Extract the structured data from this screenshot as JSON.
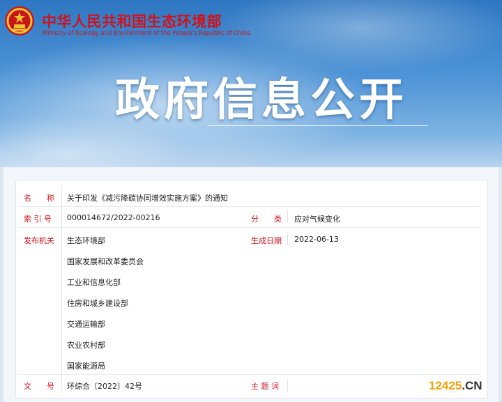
{
  "header": {
    "ministry_cn": "中华人民共和国生态环境部",
    "ministry_en": "Ministry of Ecology and Environment of the People's Republic of China",
    "banner_title": "政府信息公开",
    "emblem_icon": "national-emblem-icon"
  },
  "info": {
    "name_label": "名　　称",
    "name_value": "关于印发《减污降碳协同增效实施方案》的通知",
    "index_label": "索 引 号",
    "index_value": "000014672/2022-00216",
    "category_label": "分　　类",
    "category_value": "应对气候变化",
    "issuer_label": "发布机关",
    "issuers": [
      "生态环境部",
      "国家发展和改革委员会",
      "工业和信息化部",
      "住房和城乡建设部",
      "交通运输部",
      "农业农村部",
      "国家能源局"
    ],
    "date_label": "生成日期",
    "date_value": "2022-06-13",
    "doc_no_label": "文　　号",
    "doc_no_value": "环综合〔2022〕42号",
    "keywords_label": "主 题 词",
    "keywords_value": ""
  },
  "watermark": {
    "num": "12425",
    "suffix": ".CN"
  },
  "colors": {
    "label_red": "#d0121b",
    "banner_blue": "#2f77c2",
    "watermark_orange": "#f2a100"
  }
}
